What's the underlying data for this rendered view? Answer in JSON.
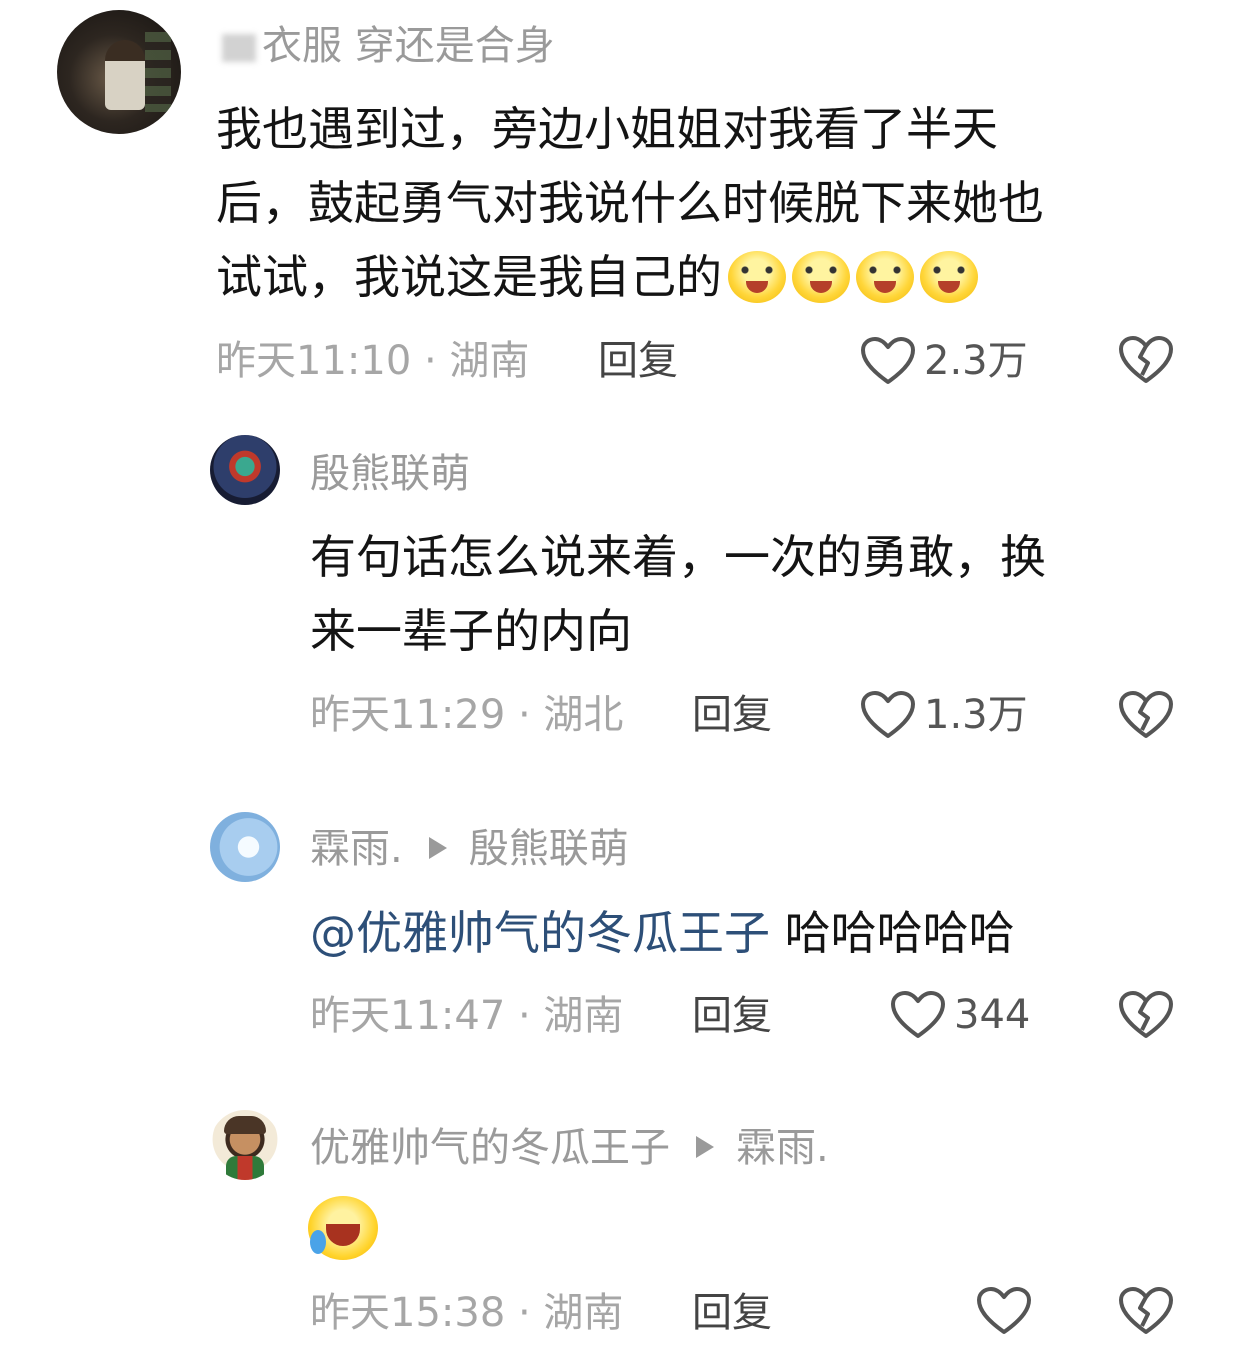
{
  "comments": [
    {
      "username": "衣服 穿还是合身",
      "text_lines": [
        "我也遇到过，旁边小姐姐对我看了半天",
        "后，鼓起勇气对我说什么时候脱下来她也",
        "试试，我说这是我自己的"
      ],
      "emoji_count": 4,
      "meta": "昨天11:10 · 湖南",
      "reply_label": "回复",
      "likes": "2.3万"
    },
    {
      "username": "殷熊联萌",
      "text_lines": [
        "有句话怎么说来着，一次的勇敢，换",
        "来一辈子的内向"
      ],
      "meta": "昨天11:29 · 湖北",
      "reply_label": "回复",
      "likes": "1.3万"
    },
    {
      "username": "霖雨.",
      "reply_to": "殷熊联萌",
      "mention": "@优雅帅气的冬瓜王子",
      "text": "哈哈哈哈哈",
      "meta": "昨天11:47 · 湖南",
      "reply_label": "回复",
      "likes": "344"
    },
    {
      "username": "优雅帅气的冬瓜王子",
      "reply_to": "霖雨.",
      "meta": "昨天15:38 · 湖南",
      "reply_label": "回复",
      "likes": ""
    }
  ],
  "icons": {
    "like": "heart-outline-icon",
    "dislike": "broken-heart-icon",
    "reply_arrow": "triangle-right-icon"
  },
  "colors": {
    "mention": "#2d4f78",
    "meta": "#a6a6a6"
  }
}
